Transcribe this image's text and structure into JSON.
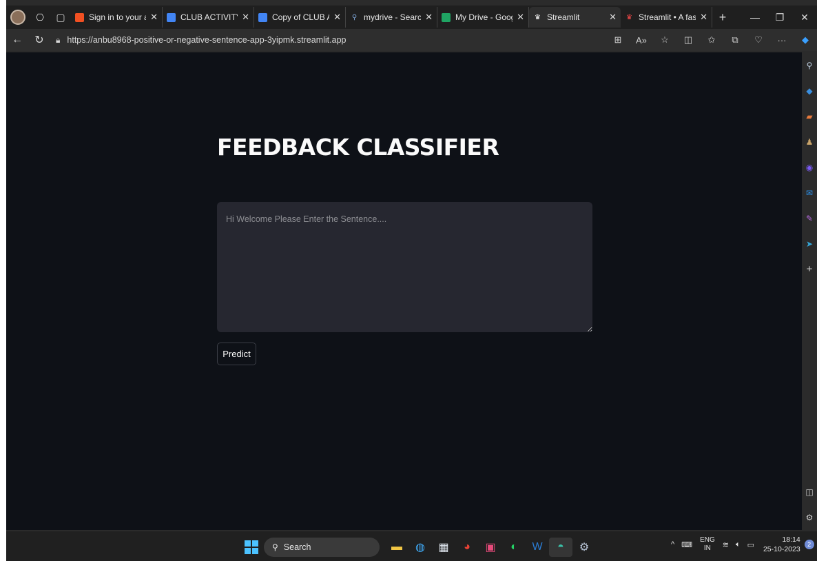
{
  "browser": {
    "tabs": [
      {
        "title": "Sign in to your acco",
        "fav_color": "#f25022",
        "active": false
      },
      {
        "title": "CLUB ACTIVITY VOL",
        "fav_color": "#4285f4",
        "active": false
      },
      {
        "title": "Copy of CLUB ACTI\\",
        "fav_color": "#4285f4",
        "active": false
      },
      {
        "title": "mydrive - Search",
        "fav_color": "#3a6ea5",
        "active": false
      },
      {
        "title": "My Drive - Google I",
        "fav_color": "#1fa463",
        "active": false
      },
      {
        "title": "Streamlit",
        "fav_color": "#ff4b4b",
        "active": true
      },
      {
        "title": "Streamlit • A faster",
        "fav_color": "#ff4b4b",
        "active": false
      }
    ],
    "url": "https://anbu8968-positive-or-negative-sentence-app-3yipmk.streamlit.app"
  },
  "app": {
    "title": "FEEDBACK CLASSIFIER",
    "textarea_placeholder": "Hi Welcome Please Enter the Sentence....",
    "textarea_value": "",
    "predict_label": "Predict"
  },
  "taskbar": {
    "search_label": "Search",
    "lang_line1": "ENG",
    "lang_line2": "IN",
    "time": "18:14",
    "date": "25-10-2023",
    "notification_count": "2"
  }
}
